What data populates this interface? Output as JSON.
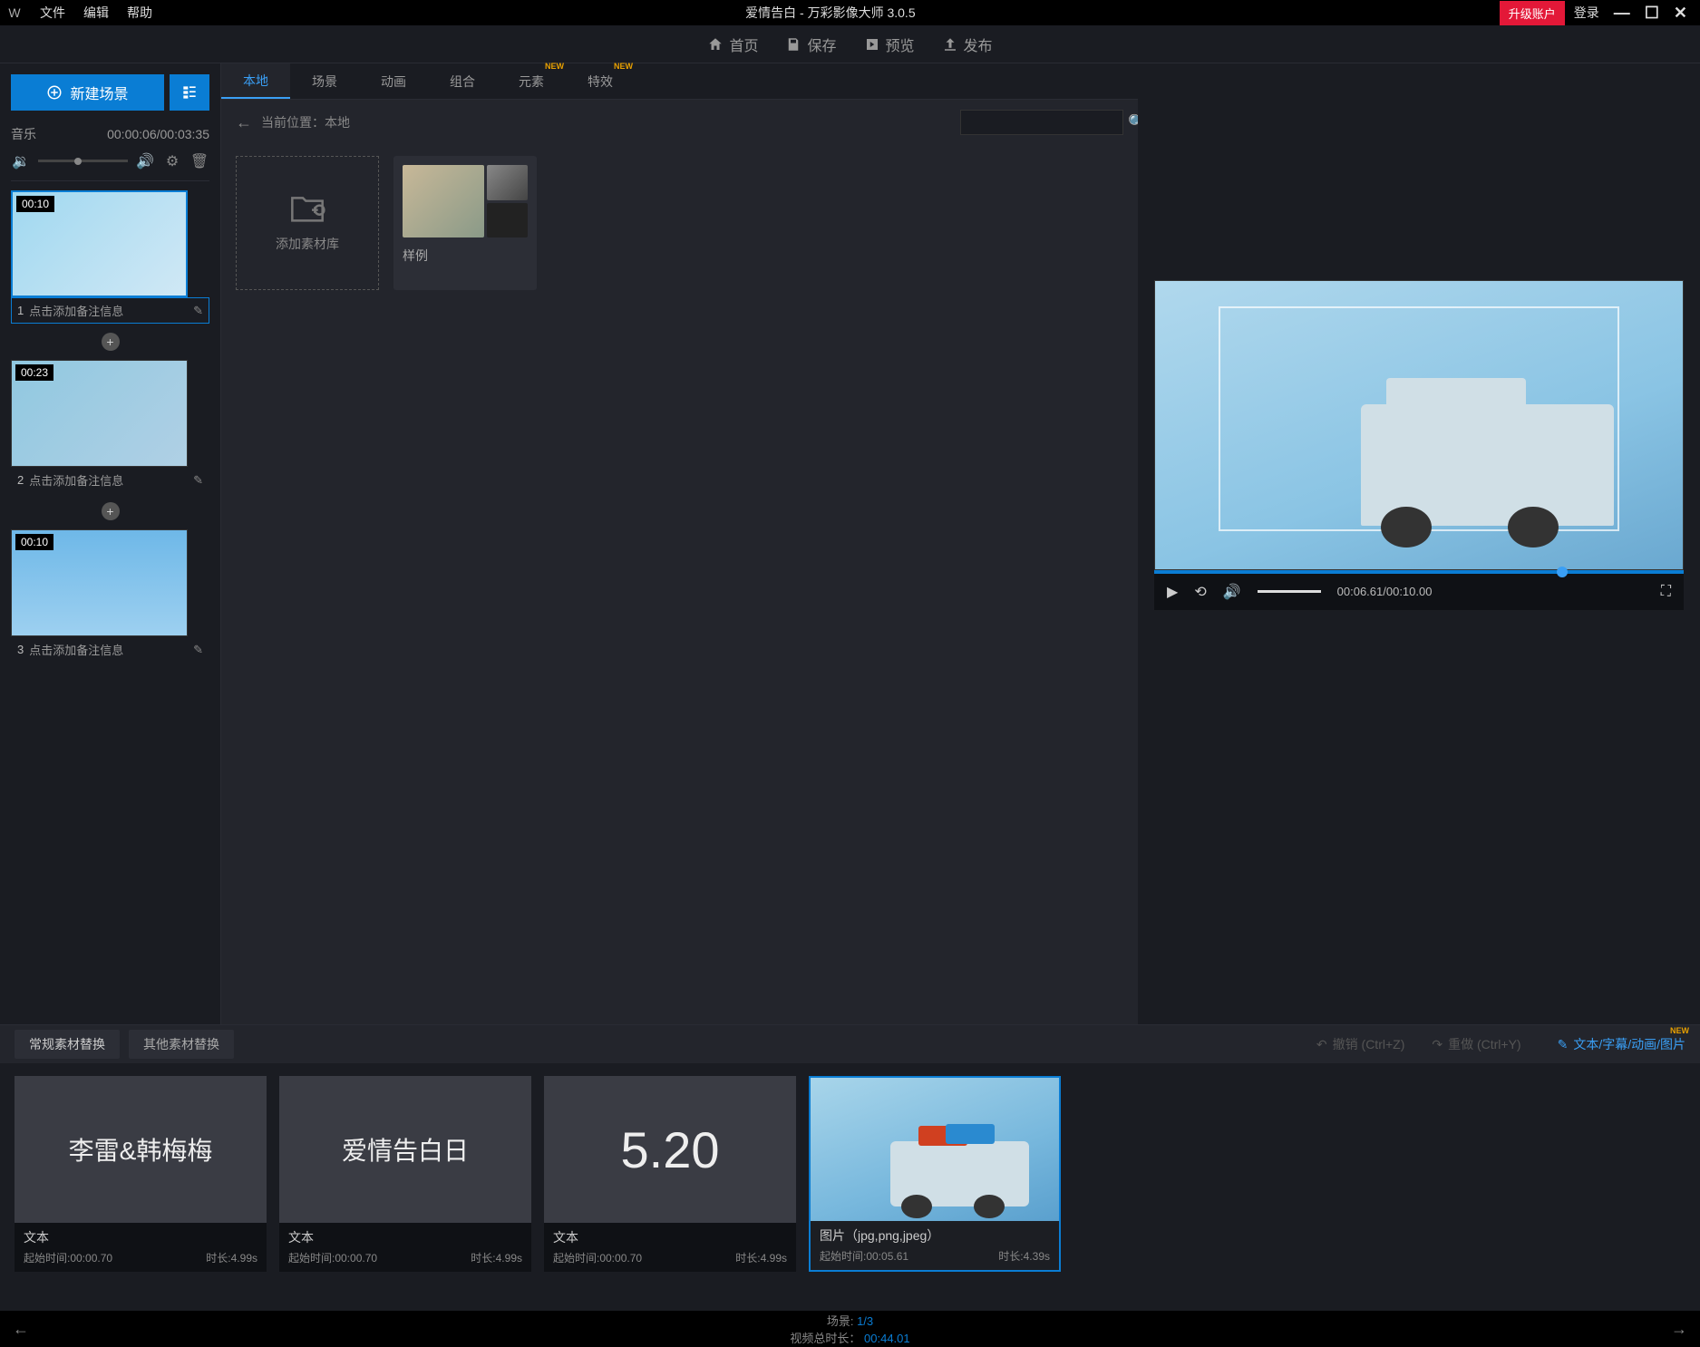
{
  "titlebar": {
    "menu": {
      "file": "文件",
      "edit": "编辑",
      "help": "帮助"
    },
    "app_title": "爱情告白 - 万彩影像大师 3.0.5",
    "upgrade": "升级账户",
    "login": "登录"
  },
  "toolbar": {
    "home": "首页",
    "save": "保存",
    "preview": "预览",
    "publish": "发布"
  },
  "sidebar": {
    "new_scene": "新建场景",
    "music_label": "音乐",
    "music_time": "00:00:06/00:03:35",
    "scenes": [
      {
        "num": "1",
        "duration": "00:10",
        "caption": "点击添加备注信息",
        "selected": true
      },
      {
        "num": "2",
        "duration": "00:23",
        "caption": "点击添加备注信息",
        "selected": false
      },
      {
        "num": "3",
        "duration": "00:10",
        "caption": "点击添加备注信息",
        "selected": false
      }
    ]
  },
  "center": {
    "tabs": [
      {
        "label": "本地",
        "active": true,
        "new": false
      },
      {
        "label": "场景",
        "active": false,
        "new": false
      },
      {
        "label": "动画",
        "active": false,
        "new": false
      },
      {
        "label": "组合",
        "active": false,
        "new": false
      },
      {
        "label": "元素",
        "active": false,
        "new": true
      },
      {
        "label": "特效",
        "active": false,
        "new": true
      }
    ],
    "breadcrumb_prefix": "当前位置：",
    "breadcrumb_value": "本地",
    "add_library": "添加素材库",
    "sample": "样例"
  },
  "preview": {
    "time": "00:06.61/00:10.00"
  },
  "bottom": {
    "tab1": "常规素材替换",
    "tab2": "其他素材替换",
    "undo": "撤销 (Ctrl+Z)",
    "redo": "重做 (Ctrl+Y)",
    "text_link": "文本/字幕/动画/图片",
    "clips": [
      {
        "preview_text": "李雷&韩梅梅",
        "type": "文本",
        "start": "起始时间:00:00.70",
        "dur": "时长:4.99s",
        "selected": false,
        "is_image": false
      },
      {
        "preview_text": "爱情告白日",
        "type": "文本",
        "start": "起始时间:00:00.70",
        "dur": "时长:4.99s",
        "selected": false,
        "is_image": false
      },
      {
        "preview_text": "5.20",
        "type": "文本",
        "start": "起始时间:00:00.70",
        "dur": "时长:4.99s",
        "selected": false,
        "is_image": false,
        "big": true
      },
      {
        "preview_text": "",
        "type": "图片（jpg,png,jpeg）",
        "start": "起始时间:00:05.61",
        "dur": "时长:4.39s",
        "selected": true,
        "is_image": true
      }
    ]
  },
  "footer": {
    "scene_label": "场景:",
    "scene_value": "1/3",
    "total_label": "视频总时长：",
    "total_value": "00:44.01"
  }
}
